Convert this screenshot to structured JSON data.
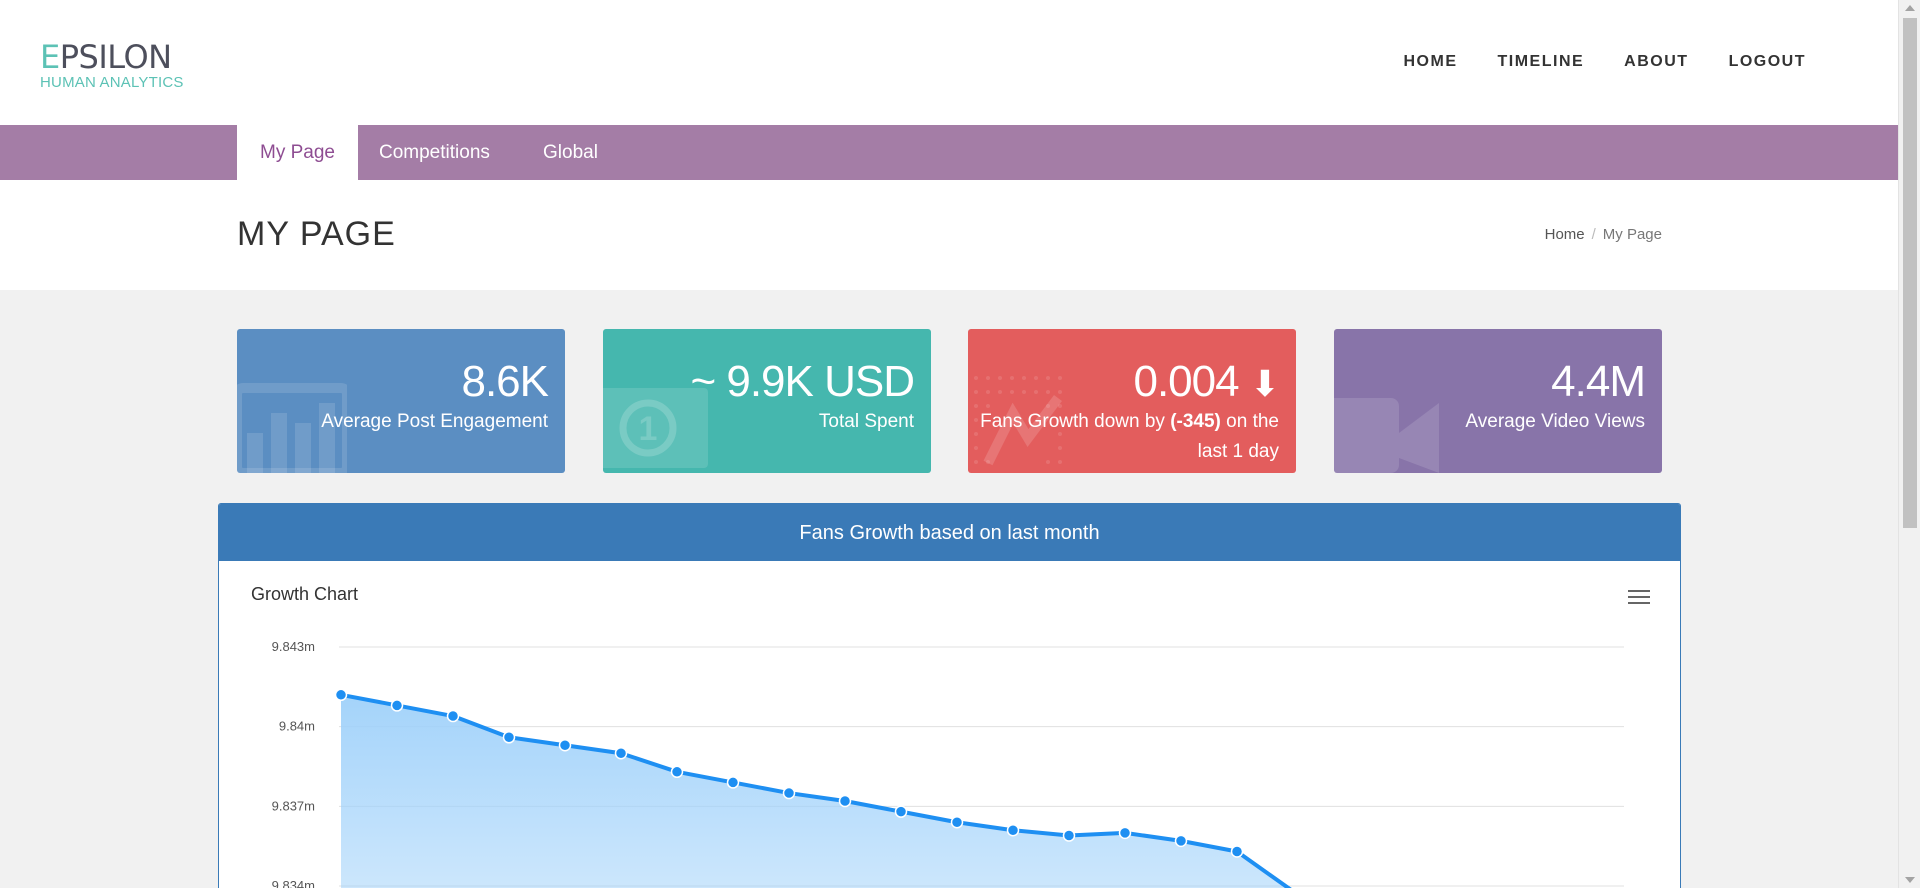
{
  "logo": {
    "first_letter": "E",
    "rest": "PSILON",
    "subtitle": "HUMAN ANALYTICS"
  },
  "topnav": [
    "HOME",
    "TIMELINE",
    "ABOUT",
    "LOGOUT"
  ],
  "tabs": [
    {
      "label": "My Page",
      "active": true
    },
    {
      "label": "Competitions",
      "active": false
    },
    {
      "label": "Global",
      "active": false
    }
  ],
  "page": {
    "title": "MY PAGE"
  },
  "breadcrumb": {
    "home": "Home",
    "separator": "/",
    "current": "My Page"
  },
  "cards": {
    "engagement": {
      "value": "8.6K",
      "label": "Average Post Engagement",
      "color": "#5b8ec2",
      "icon": "bar-chart-icon"
    },
    "spent": {
      "value": "~ 9.9K USD",
      "label": "Total Spent",
      "color": "#45b7ae",
      "icon": "money-icon"
    },
    "fans": {
      "value": "0.004",
      "arrow": "⬇",
      "label_pre": "Fans Growth down by ",
      "label_bold": "(-345)",
      "label_post": " on the last 1 day",
      "color": "#e35d5d",
      "icon": "line-chart-icon"
    },
    "video": {
      "value": "4.4M",
      "label": "Average Video Views",
      "color": "#8874a9",
      "icon": "video-camera-icon"
    }
  },
  "panel": {
    "heading": "Fans Growth based on last month",
    "color": "#3a7ab7"
  },
  "chart_data": {
    "type": "area",
    "title": "Growth Chart",
    "ylabel": "",
    "xlabel": "",
    "yticks": [
      "9.843m",
      "9.84m",
      "9.837m",
      "9.834m"
    ],
    "ylim": [
      9.834,
      9.843
    ],
    "grid": true,
    "line_color": "#1e8ff2",
    "fill_color": "#9fd1fa",
    "series": [
      {
        "values": [
          9.8412,
          9.8408,
          9.8404,
          9.8396,
          9.8393,
          9.839,
          9.8383,
          9.8379,
          9.8375,
          9.8372,
          9.8368,
          9.8364,
          9.8361,
          9.8359,
          9.836,
          9.8357,
          9.8353,
          9.8338
        ]
      }
    ]
  }
}
